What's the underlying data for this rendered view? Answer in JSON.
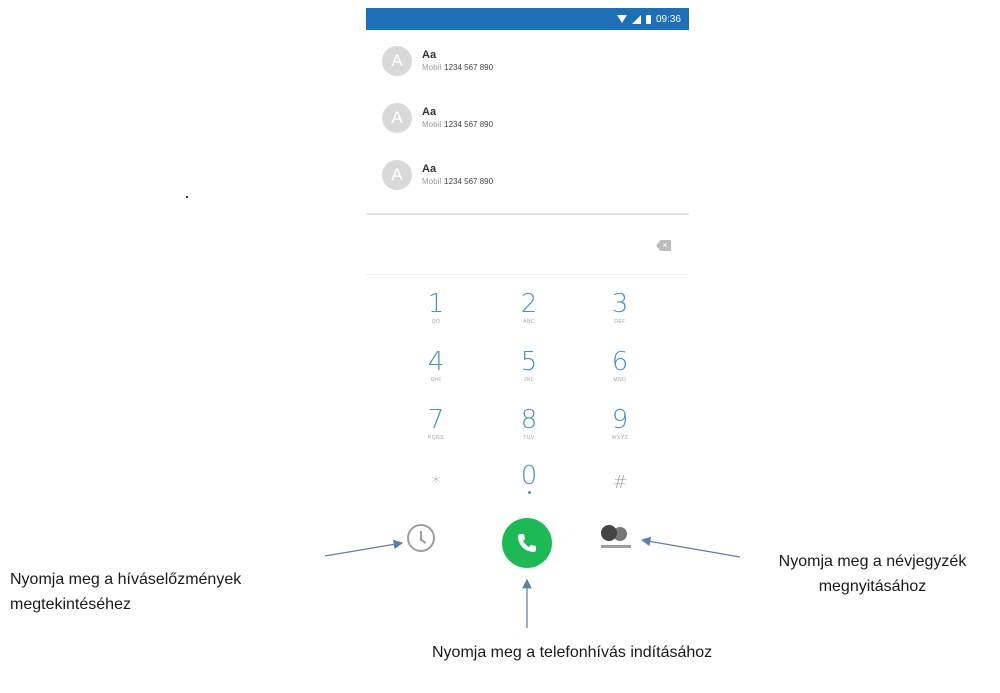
{
  "status_bar": {
    "time": "09:36"
  },
  "contacts": [
    {
      "initial": "A",
      "name": "Aa",
      "type": "Mobil",
      "number": "1234 567 890"
    },
    {
      "initial": "A",
      "name": "Aa",
      "type": "Mobil",
      "number": "1234 567 890"
    },
    {
      "initial": "A",
      "name": "Aa",
      "type": "Mobil",
      "number": "1234 567 890"
    }
  ],
  "keypad": [
    {
      "digit": "1",
      "letters": "QO"
    },
    {
      "digit": "2",
      "letters": "ABC"
    },
    {
      "digit": "3",
      "letters": "DEF"
    },
    {
      "digit": "4",
      "letters": "GHI"
    },
    {
      "digit": "5",
      "letters": "JKL"
    },
    {
      "digit": "6",
      "letters": "MNO"
    },
    {
      "digit": "7",
      "letters": "PQRS"
    },
    {
      "digit": "8",
      "letters": "TUV"
    },
    {
      "digit": "9",
      "letters": "WXYZ"
    },
    {
      "digit": "*",
      "letters": ""
    },
    {
      "digit": "0",
      "letters": ""
    },
    {
      "digit": "#",
      "letters": ""
    }
  ],
  "annotations": {
    "history": "Nyomja meg a híváselőzmények megtekintéséhez",
    "contacts": "Nyomja meg a névjegyzék megnyitásához",
    "call": "Nyomja meg a telefonhívás indításához"
  },
  "colors": {
    "status_bar": "#1d6fb8",
    "call_button": "#1db954",
    "key_digit": "#4a90c4"
  },
  "icons": {
    "history": "clock-icon",
    "call": "phone-icon",
    "contacts": "contacts-icon",
    "backspace": "backspace-icon"
  }
}
